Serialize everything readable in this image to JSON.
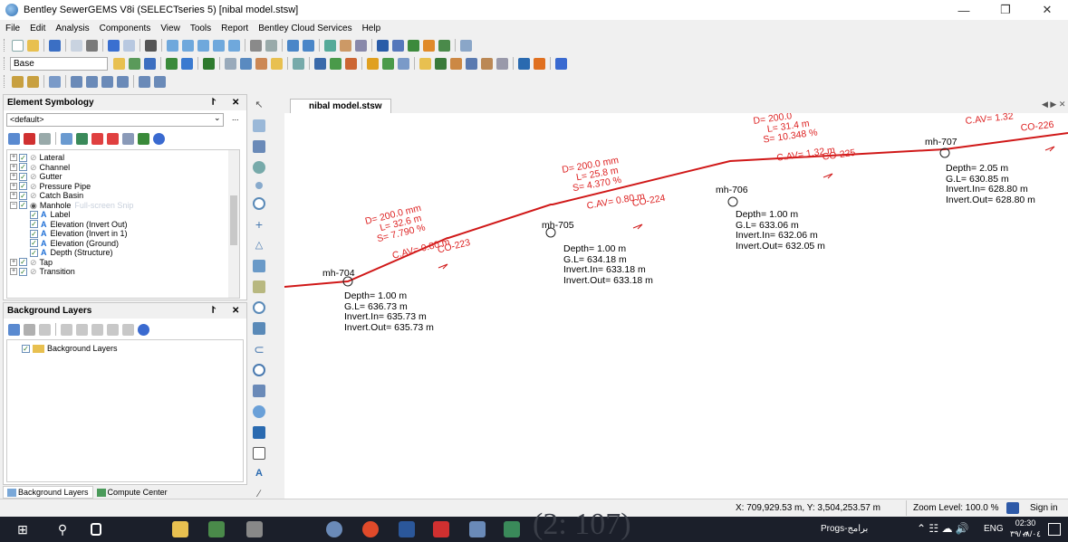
{
  "window": {
    "title": "Bentley SewerGEMS V8i (SELECTseries 5) [nibal model.stsw]"
  },
  "menu": [
    "File",
    "Edit",
    "Analysis",
    "Components",
    "View",
    "Tools",
    "Report",
    "Bentley Cloud Services",
    "Help"
  ],
  "toolbar": {
    "scenario": "Base"
  },
  "symbology": {
    "title": "Element Symbology",
    "selector": "<default>",
    "items": [
      {
        "label": "Lateral",
        "indent": 0
      },
      {
        "label": "Channel",
        "indent": 0
      },
      {
        "label": "Gutter",
        "indent": 0
      },
      {
        "label": "Pressure Pipe",
        "indent": 0
      },
      {
        "label": "Catch Basin",
        "indent": 0
      },
      {
        "label": "Manhole",
        "indent": 0
      },
      {
        "label": "Label",
        "indent": 1
      },
      {
        "label": "Elevation (Invert Out)",
        "indent": 1
      },
      {
        "label": "Elevation (Invert in 1)",
        "indent": 1
      },
      {
        "label": "Elevation (Ground)",
        "indent": 1
      },
      {
        "label": "Depth (Structure)",
        "indent": 1
      },
      {
        "label": "Tap",
        "indent": 0
      },
      {
        "label": "Transition",
        "indent": 0
      }
    ],
    "ghost_text": "Full-screen Snip"
  },
  "background": {
    "title": "Background Layers",
    "items": [
      "Background Layers"
    ]
  },
  "bottom_tabs": [
    "Background Layers",
    "Compute Center"
  ],
  "document_tab": "nibal model.stsw",
  "drawing": {
    "manholes": [
      {
        "id": "mh-704",
        "depth": "Depth= 1.00 m",
        "gl": "G.L= 636.73 m",
        "inv_in": "Invert.In= 635.73 m",
        "inv_out": "Invert.Out= 635.73 m"
      },
      {
        "id": "mh-705",
        "depth": "Depth= 1.00 m",
        "gl": "G.L= 634.18 m",
        "inv_in": "Invert.In= 633.18 m",
        "inv_out": "Invert.Out= 633.18 m"
      },
      {
        "id": "mh-706",
        "depth": "Depth= 1.00 m",
        "gl": "G.L= 633.06 m",
        "inv_in": "Invert.In= 632.06 m",
        "inv_out": "Invert.Out= 632.05 m"
      },
      {
        "id": "mh-707",
        "depth": "Depth= 2.05 m",
        "gl": "G.L= 630.85 m",
        "inv_in": "Invert.In= 628.80 m",
        "inv_out": "Invert.Out= 628.80 m"
      }
    ],
    "conduits": [
      {
        "id": "CO-223",
        "d": "D= 200.0 mm",
        "l": "L= 32.6 m",
        "s": "S= 7.790 %",
        "cav": "C.AV= 0.80 m"
      },
      {
        "id": "CO-224",
        "d": "D= 200.0 mm",
        "l": "L= 25.8 m",
        "s": "S= 4.370 %",
        "cav": "C.AV= 0.80 m"
      },
      {
        "id": "CO-225",
        "d": "D= 200.0",
        "l": "L= 31.4 m",
        "s": "S= 10.348 %",
        "cav": "C.AV= 1.32 m"
      },
      {
        "id": "CO-226",
        "cav": "C.AV= 1.32"
      }
    ]
  },
  "status": {
    "coords": "X: 709,929.53 m, Y: 3,504,253.57 m",
    "zoom": "Zoom Level: 100.0 %",
    "signin": "Sign in"
  },
  "taskbar": {
    "tray_label": "Progs-برامج",
    "lang": "ENG",
    "time": "02:30 م",
    "date": "٣٩/٠٨/٠٤",
    "watermark": "(2: 107)"
  }
}
